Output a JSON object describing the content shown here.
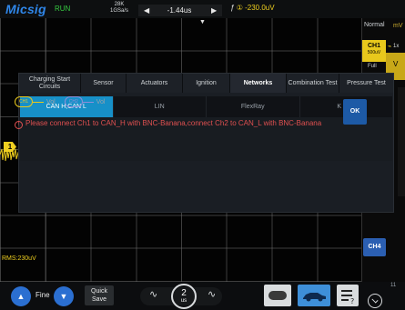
{
  "topbar": {
    "brand": "Micsig",
    "run_state": "RUN",
    "sample_rate_line1": "28K",
    "sample_rate_line2": "1GSa/s",
    "time_left_arrow": "◀",
    "time_offset": "-1.44us",
    "time_right_arrow": "▶",
    "trigger_edge": "ƒ",
    "trigger_source": "①",
    "trigger_level": "-230.0uV"
  },
  "scope": {
    "trigger_position_marker": "▼",
    "ch1_marker": "1",
    "measurement": "RMS:230uV"
  },
  "right_panel": {
    "acquire_mode": "Normal",
    "unit_hint": "mV",
    "ch1_label": "CH1",
    "ch1_scale": "500uV",
    "ch1_arrow": "⌁",
    "ch1_side_label": "V",
    "bandwidth": "Full",
    "side_number": "1x",
    "ch4_label": "CH4"
  },
  "dialog": {
    "tabs": [
      {
        "label": "Charging Start Circuits",
        "active": false
      },
      {
        "label": "Sensor",
        "active": false
      },
      {
        "label": "Actuators",
        "active": false
      },
      {
        "label": "Ignition",
        "active": false
      },
      {
        "label": "Networks",
        "active": true
      },
      {
        "label": "Combination Test",
        "active": false
      },
      {
        "label": "Pressure Test",
        "active": false
      }
    ],
    "subtabs": [
      {
        "label": "CAN H,CAN L",
        "active": true
      },
      {
        "label": "LIN",
        "active": false
      },
      {
        "label": "FlexRay",
        "active": false
      },
      {
        "label": "K Line",
        "active": false
      }
    ],
    "legend": [
      {
        "channel": "CH1",
        "label": "Vol",
        "color": "#e8c81c"
      },
      {
        "channel": "CH2",
        "label": "Vol",
        "color": "#8f8fd8"
      }
    ],
    "message_icon": "!",
    "message": "Please connect Ch1 to CAN_H with BNC-Banana,connect Ch2 to CAN_L with BNC-Banana",
    "ok_label": "OK"
  },
  "bottombar": {
    "up_icon": "▲",
    "fine_label": "Fine",
    "down_icon": "▼",
    "quick_save_line1": "Quick",
    "quick_save_line2": "Save",
    "wave_left_icon": "∿",
    "zoom_value": "2",
    "zoom_unit": "us",
    "wave_right_icon": "∿",
    "edge_number": "11"
  },
  "colors": {
    "accent_blue": "#1790c8",
    "ch1_yellow": "#e8c81c",
    "alert_red": "#e05050",
    "run_green": "#35c840"
  }
}
